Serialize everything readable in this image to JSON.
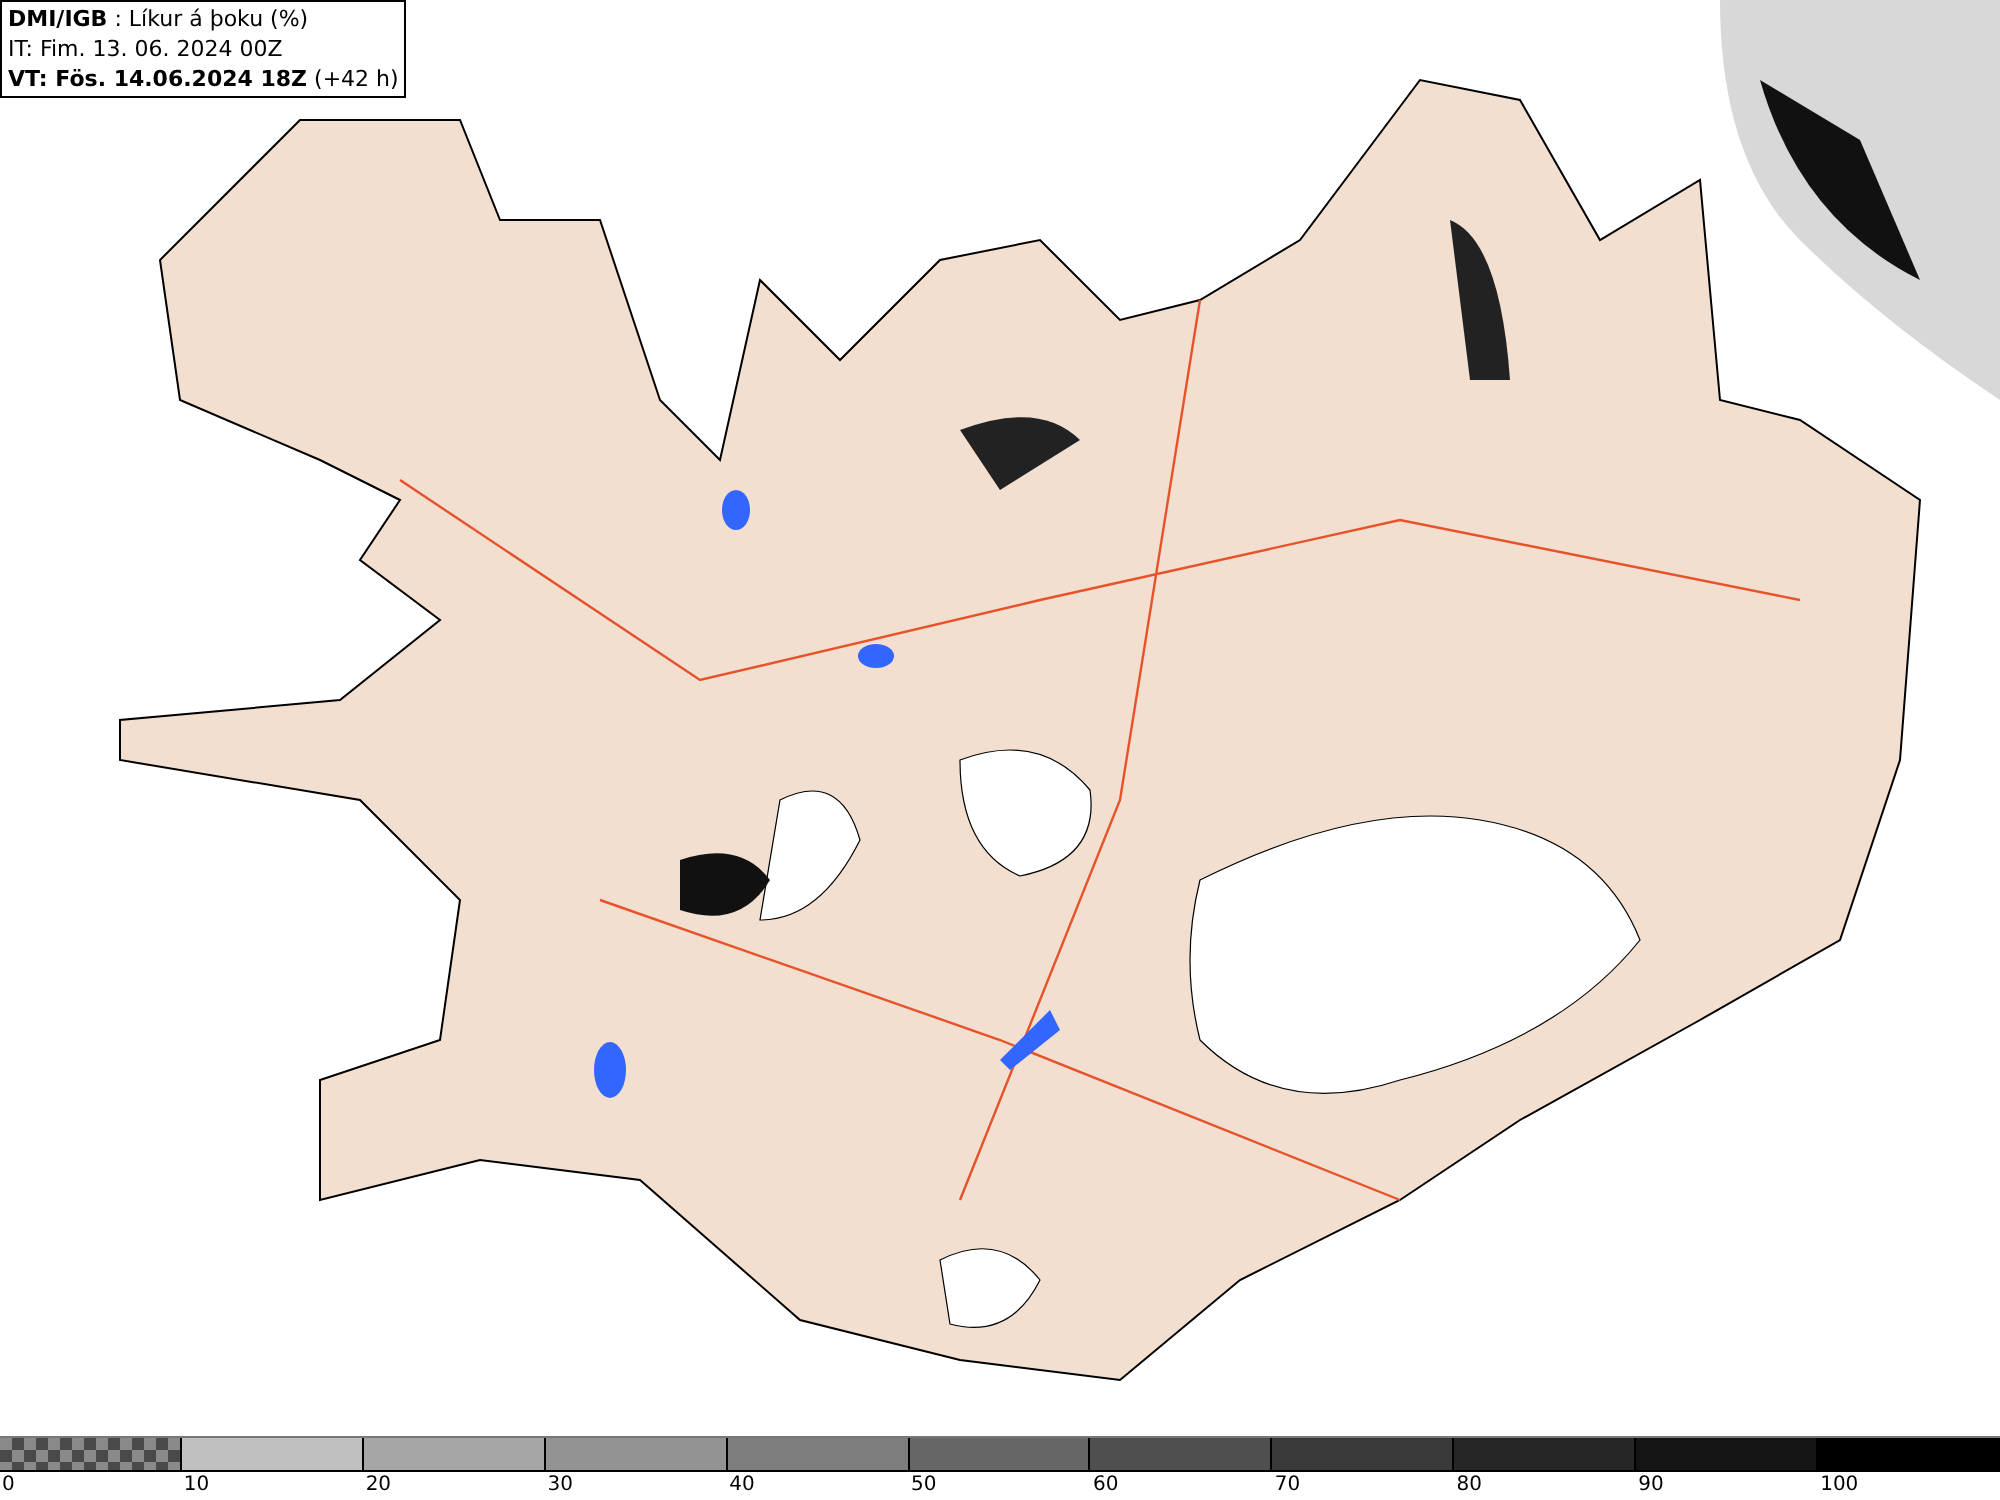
{
  "header": {
    "lines": [
      "**DMI/IGB** : Líkur á þoku (%)",
      "IT: Fim. 13. 06. 2024 00Z",
      "**VT: Fös. 14.06.2024 18Z** (+42 h)"
    ]
  },
  "legend": {
    "segments": [
      {
        "kind": "checker",
        "color": "#8a8a8a"
      },
      {
        "kind": "solid",
        "color": "#c0c0c0"
      },
      {
        "kind": "solid",
        "color": "#a6a6a6"
      },
      {
        "kind": "solid",
        "color": "#939393"
      },
      {
        "kind": "solid",
        "color": "#7d7d7d"
      },
      {
        "kind": "solid",
        "color": "#666666"
      },
      {
        "kind": "solid",
        "color": "#4f4f4f"
      },
      {
        "kind": "solid",
        "color": "#3a3a3a"
      },
      {
        "kind": "solid",
        "color": "#262626"
      },
      {
        "kind": "solid",
        "color": "#141414"
      },
      {
        "kind": "solid",
        "color": "#000000"
      }
    ],
    "labels": [
      "0",
      "10",
      "20",
      "30",
      "40",
      "50",
      "60",
      "70",
      "80",
      "90",
      "100"
    ]
  }
}
